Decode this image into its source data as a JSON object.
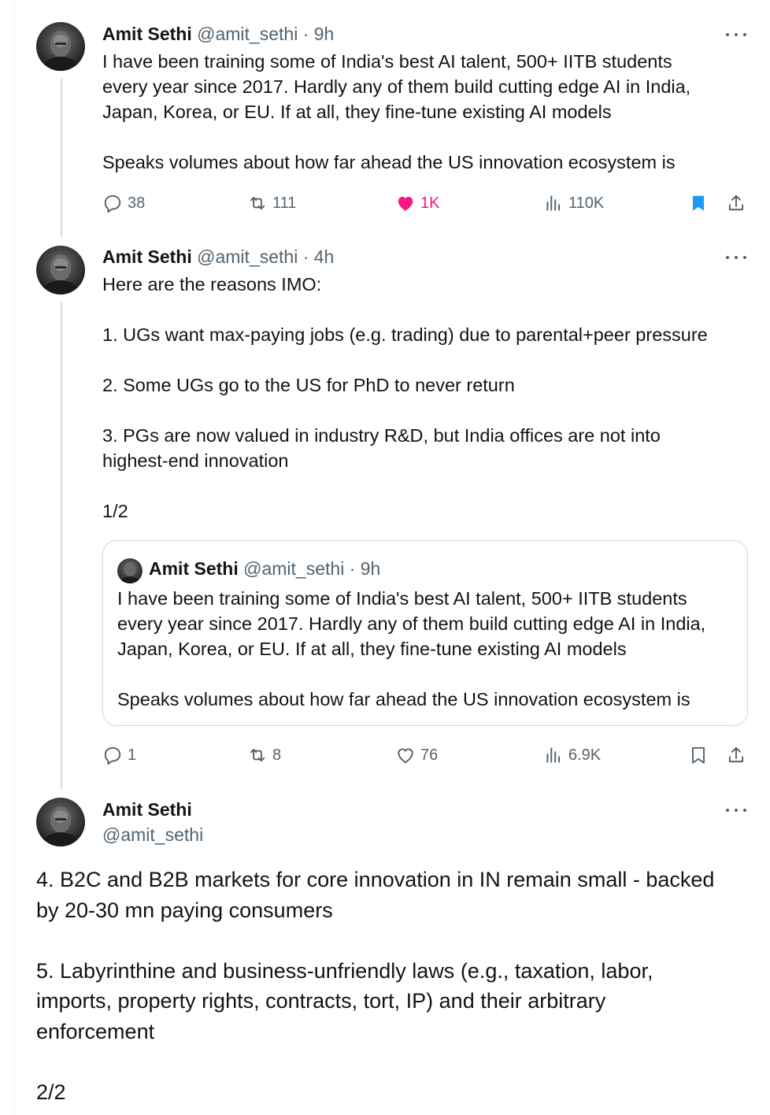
{
  "tweets": [
    {
      "name": "Amit Sethi",
      "handle": "@amit_sethi",
      "time": "· 9h",
      "text": "I have been training some of India's best AI talent, 500+ IITB students\nevery year since 2017. Hardly any of them build cutting edge AI in India,\nJapan, Korea, or EU. If at all, they fine-tune existing AI models\n\nSpeaks volumes about how far ahead the US innovation ecosystem is",
      "stats": {
        "replies": "38",
        "reposts": "111",
        "likes": "1K",
        "views": "110K"
      },
      "liked": true,
      "bookmarked": true
    },
    {
      "name": "Amit Sethi",
      "handle": "@amit_sethi",
      "time": "· 4h",
      "text": "Here are the reasons IMO:\n\n1. UGs want max-paying jobs (e.g. trading) due to parental+peer pressure\n\n2. Some UGs go to the US for PhD to never return\n\n3. PGs are now valued in industry R&D, but India offices are not into\nhighest-end innovation\n\n1/2",
      "quote": {
        "name": "Amit Sethi",
        "handle": "@amit_sethi",
        "time": "· 9h",
        "text": "I have been training some of India's best AI talent, 500+ IITB students\nevery year since 2017. Hardly any of them build cutting edge AI in India,\nJapan, Korea, or EU. If at all, they fine-tune existing AI models\n\nSpeaks volumes about how far ahead the US innovation ecosystem is"
      },
      "stats": {
        "replies": "1",
        "reposts": "8",
        "likes": "76",
        "views": "6.9K"
      },
      "liked": false,
      "bookmarked": false
    },
    {
      "name": "Amit Sethi",
      "handle": "@amit_sethi",
      "text": "4. B2C and B2B markets for core innovation in IN remain small - backed\nby 20-30 mn paying consumers\n\n5. Labyrinthine and business-unfriendly laws (e.g., taxation, labor,\nimports, property rights, contracts, tort, IP) and their arbitrary\nenforcement\n\n2/2"
    }
  ],
  "colors": {
    "text": "#0f1419",
    "secondary": "#536471",
    "like": "#f91880",
    "bookmark": "#1d9bf0",
    "border": "#cfd9de"
  }
}
